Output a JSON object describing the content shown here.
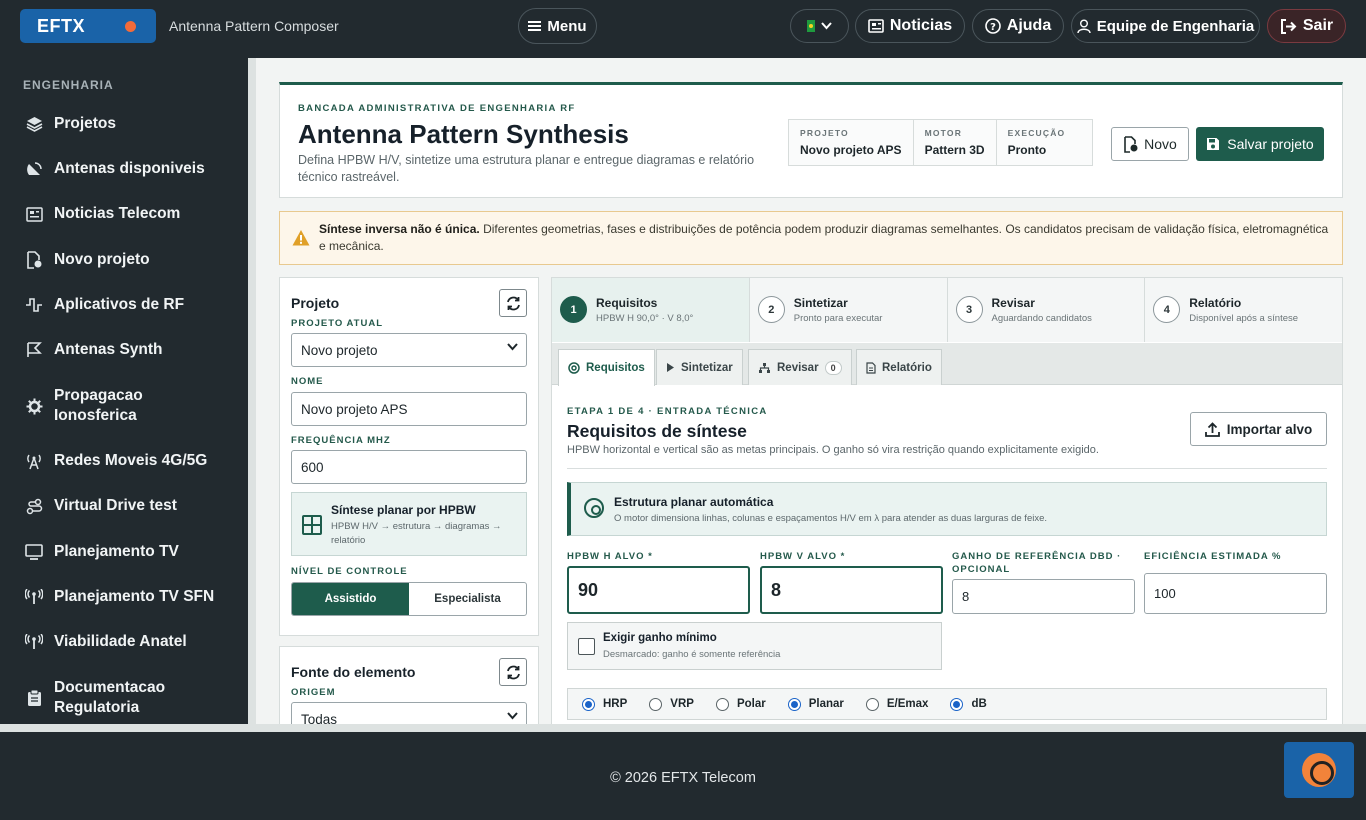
{
  "topbar": {
    "brand": "EFTX",
    "app_subtitle": "Antenna Pattern Composer",
    "menu_label": "Menu",
    "noticias_label": "Noticias",
    "ajuda_label": "Ajuda",
    "equipe_label": "Equipe de Engenharia",
    "sair_label": "Sair"
  },
  "sidebar": {
    "section_title": "ENGENHARIA",
    "items": [
      {
        "label": "Projetos",
        "icon": "layers-icon"
      },
      {
        "label": "Antenas disponiveis",
        "icon": "satellite-icon"
      },
      {
        "label": "Noticias Telecom",
        "icon": "newspaper-icon"
      },
      {
        "label": "Novo projeto",
        "icon": "file-add-icon"
      },
      {
        "label": "Aplicativos de RF",
        "icon": "waveform-icon"
      },
      {
        "label": "Antenas Synth",
        "icon": "antenna-synth-icon"
      },
      {
        "label": "Propagacao Ionosferica",
        "icon": "gear-icon"
      },
      {
        "label": "Redes Moveis 4G/5G",
        "icon": "tower-icon"
      },
      {
        "label": "Virtual Drive test",
        "icon": "route-icon"
      },
      {
        "label": "Planejamento TV",
        "icon": "monitor-icon"
      },
      {
        "label": "Planejamento TV SFN",
        "icon": "broadcast-icon"
      },
      {
        "label": "Viabilidade Anatel",
        "icon": "broadcast-icon"
      },
      {
        "label": "Documentacao Regulatoria",
        "icon": "clipboard-icon"
      }
    ]
  },
  "header": {
    "eyebrow": "BANCADA ADMINISTRATIVA DE ENGENHARIA RF",
    "title": "Antenna Pattern Synthesis",
    "description": "Defina HPBW H/V, sintetize uma estrutura planar e entregue diagramas e relatório técnico rastreável.",
    "meta": [
      {
        "key": "PROJETO",
        "value": "Novo projeto APS"
      },
      {
        "key": "MOTOR",
        "value": "Pattern 3D"
      },
      {
        "key": "EXECUÇÃO",
        "value": "Pronto"
      }
    ],
    "btn_novo": "Novo",
    "btn_salvar": "Salvar projeto"
  },
  "warning": {
    "bold": "Síntese inversa não é única.",
    "text": " Diferentes geometrias, fases e distribuições de potência podem produzir diagramas semelhantes. Os candidatos precisam de validação física, eletromagnética e mecânica."
  },
  "project_panel": {
    "title": "Projeto",
    "current_label": "PROJETO ATUAL",
    "current_value": "Novo projeto",
    "name_label": "NOME",
    "name_value": "Novo projeto APS",
    "freq_label": "FREQUÊNCIA MHZ",
    "freq_value": "600",
    "hpbw_title": "Síntese planar por HPBW",
    "hpbw_desc": "HPBW H/V → estrutura → diagramas → relatório",
    "control_label": "NÍVEL DE CONTROLE",
    "control_options": [
      "Assistido",
      "Especialista"
    ]
  },
  "source_panel": {
    "title": "Fonte do elemento",
    "origin_label": "ORIGEM",
    "origin_value": "Todas"
  },
  "steps": [
    {
      "num": "1",
      "title": "Requisitos",
      "sub": "HPBW H 90,0° · V 8,0°"
    },
    {
      "num": "2",
      "title": "Sintetizar",
      "sub": "Pronto para executar"
    },
    {
      "num": "3",
      "title": "Revisar",
      "sub": "Aguardando candidatos"
    },
    {
      "num": "4",
      "title": "Relatório",
      "sub": "Disponível após a síntese"
    }
  ],
  "tabs": [
    {
      "label": "Requisitos"
    },
    {
      "label": "Sintetizar"
    },
    {
      "label": "Revisar",
      "badge": "0"
    },
    {
      "label": "Relatório"
    }
  ],
  "requirements": {
    "eyebrow": "ETAPA 1 DE 4 · ENTRADA TÉCNICA",
    "title": "Requisitos de síntese",
    "description": "HPBW horizontal e vertical são as metas principais. O ganho só vira restrição quando explicitamente exigido.",
    "import_label": "Importar alvo",
    "info_title": "Estrutura planar automática",
    "info_desc": "O motor dimensiona linhas, colunas e espaçamentos H/V em λ para atender as duas larguras de feixe.",
    "fields": [
      {
        "label": "HPBW H ALVO *",
        "value": "90"
      },
      {
        "label": "HPBW V ALVO *",
        "value": "8"
      },
      {
        "label": "GANHO DE REFERÊNCIA DBD · OPCIONAL",
        "value": "8"
      },
      {
        "label": "EFICIÊNCIA ESTIMADA %",
        "value": "100"
      }
    ],
    "min_gain_title": "Exigir ganho mínimo",
    "min_gain_desc": "Desmarcado: ganho é somente referência",
    "radios": [
      "HRP",
      "VRP",
      "Polar",
      "Planar",
      "E/Emax",
      "dB"
    ]
  },
  "footer": {
    "copyright": "© 2026 EFTX Telecom"
  }
}
